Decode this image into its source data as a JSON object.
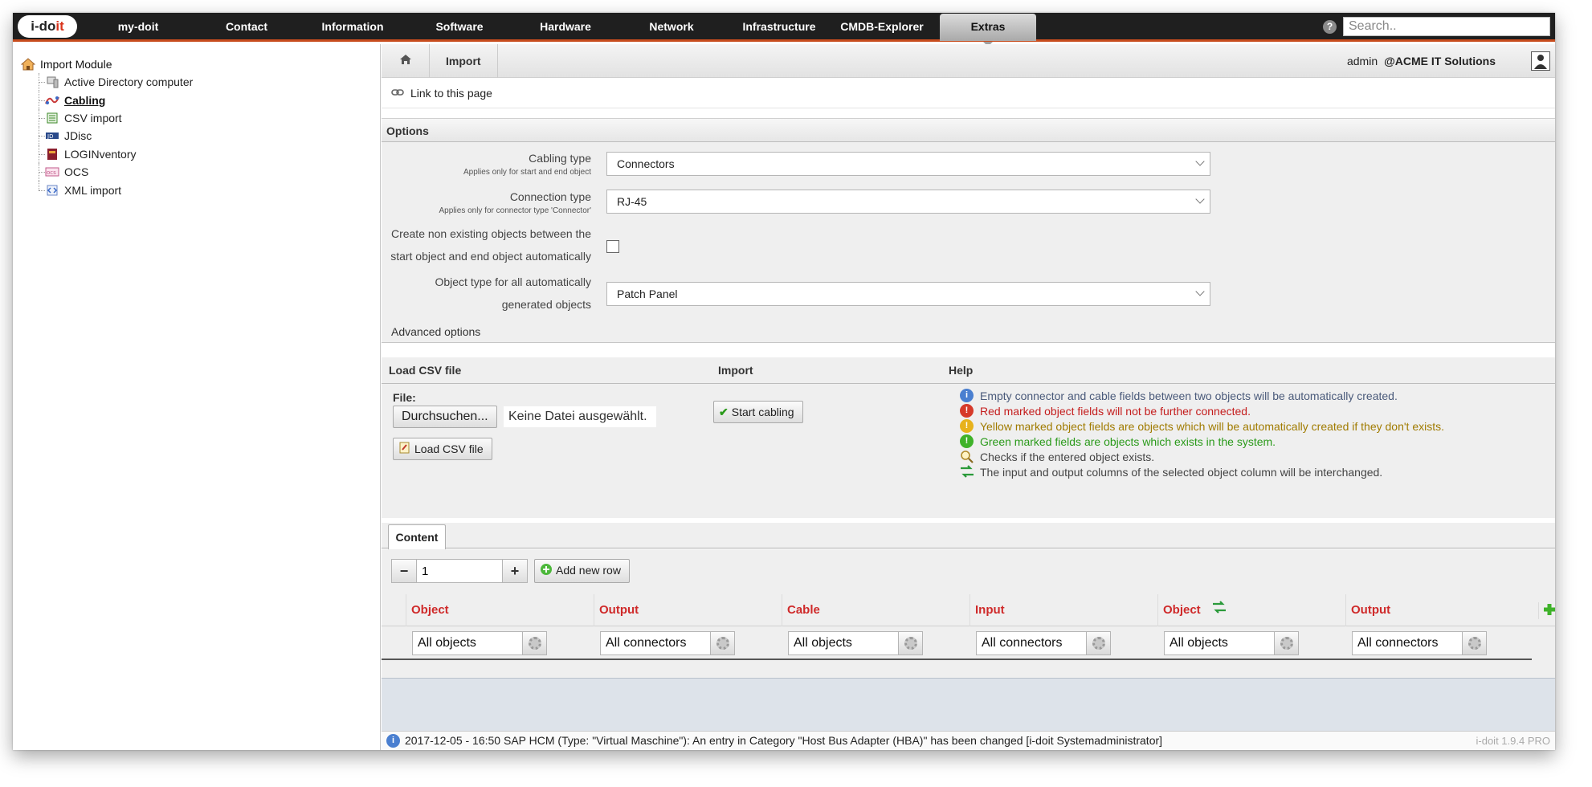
{
  "app": {
    "logo_main": "i-do",
    "logo_accent": "it"
  },
  "nav": {
    "items": [
      "my-doit",
      "Contact",
      "Information",
      "Software",
      "Hardware",
      "Network",
      "Infrastructure",
      "CMDB-Explorer",
      "Extras"
    ],
    "active": "Extras",
    "search_placeholder": "Search.."
  },
  "sidebar": {
    "root": "Import Module",
    "items": [
      {
        "label": "Active Directory computer",
        "icon": "ad-computer-icon"
      },
      {
        "label": "Cabling",
        "icon": "cabling-icon",
        "active": true
      },
      {
        "label": "CSV import",
        "icon": "csv-icon"
      },
      {
        "label": "JDisc",
        "icon": "jdisc-icon"
      },
      {
        "label": "LOGINventory",
        "icon": "loginventory-icon"
      },
      {
        "label": "OCS",
        "icon": "ocs-icon"
      },
      {
        "label": "XML import",
        "icon": "xml-icon"
      }
    ]
  },
  "breadcrumb": {
    "current": "Import",
    "user": "admin",
    "tenant": "@ACME IT Solutions"
  },
  "link_to_page": "Link to this page",
  "options": {
    "title": "Options",
    "cabling_type": {
      "label": "Cabling type",
      "sub": "Applies only for start and end object",
      "value": "Connectors"
    },
    "connection_type": {
      "label": "Connection type",
      "sub": "Applies only for connector type 'Connector'",
      "value": "RJ-45"
    },
    "create_nonexisting": {
      "label_line1": "Create non existing objects between the",
      "label_line2": "start object and end object automatically",
      "checked": false
    },
    "object_type": {
      "label_line1": "Object type for all automatically",
      "label_line2": "generated objects",
      "value": "Patch Panel"
    },
    "advanced": "Advanced options"
  },
  "load_csv": {
    "title": "Load CSV file",
    "file_label": "File:",
    "browse_button": "Durchsuchen...",
    "no_file": "Keine Datei ausgewählt.",
    "load_button": "Load CSV file"
  },
  "import": {
    "title": "Import",
    "start_button": "Start cabling"
  },
  "help": {
    "title": "Help",
    "lines": [
      {
        "text": "Empty connector and cable fields between two objects will be automatically created.",
        "color": "#4a5a7a"
      },
      {
        "text": "Red marked object fields will not be further connected.",
        "color": "#c41d1d"
      },
      {
        "text": "Yellow marked object fields are objects which will be automatically created if they don't exists.",
        "color": "#a07b00"
      },
      {
        "text": "Green marked fields are objects which exists in the system.",
        "color": "#2a9a1a"
      },
      {
        "text": "Checks if the entered object exists.",
        "color": "#444444"
      },
      {
        "text": "The input and output columns of the selected object column will be interchanged.",
        "color": "#444444"
      }
    ]
  },
  "content": {
    "tab": "Content",
    "row_count": "1",
    "add_row_button": "Add new row",
    "columns": [
      "Object",
      "Output",
      "Cable",
      "Input",
      "Object",
      "Output"
    ],
    "row": [
      "All objects",
      "All connectors",
      "All objects",
      "All connectors",
      "All objects",
      "All connectors"
    ]
  },
  "status": {
    "message": "2017-12-05 - 16:50 SAP HCM (Type: \"Virtual Maschine\"): An entry in Category \"Host Bus Adapter (HBA)\" has been changed [i-doit Systemadministrator]",
    "version": "i-doit 1.9.4 PRO"
  },
  "colors": {
    "accent": "#c84d1e",
    "header_red": "#cf2a2a"
  }
}
